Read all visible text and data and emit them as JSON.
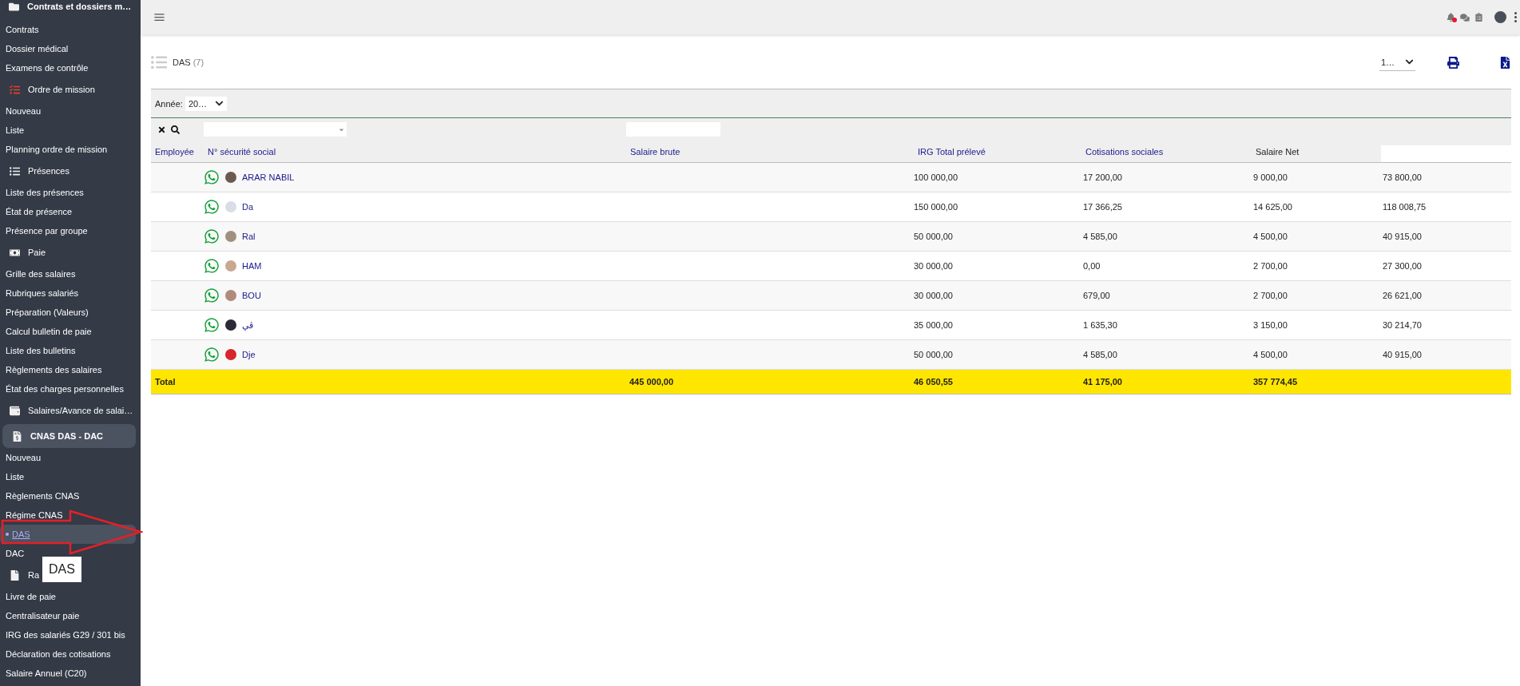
{
  "sidebar": {
    "sections": [
      {
        "kind": "group",
        "label": "Contrats et dossiers m…",
        "selected": false,
        "children": [
          {
            "label": "Contrats",
            "selected": false
          },
          {
            "label": "Dossier médical",
            "selected": false
          },
          {
            "label": "Examens de contrôle",
            "selected": false
          }
        ]
      },
      {
        "kind": "section",
        "label": "Ordre de mission",
        "selected": false,
        "children": [
          {
            "label": "Nouveau",
            "selected": false
          },
          {
            "label": "Liste",
            "selected": false
          },
          {
            "label": "Planning ordre de mission",
            "selected": false
          }
        ]
      },
      {
        "kind": "section",
        "label": "Présences",
        "selected": false,
        "children": [
          {
            "label": "Liste des présences",
            "selected": false
          },
          {
            "label": "État de présence",
            "selected": false
          },
          {
            "label": "Présence par groupe",
            "selected": false
          }
        ]
      },
      {
        "kind": "section",
        "label": "Paie",
        "selected": false,
        "children": [
          {
            "label": "Grille des salaires",
            "selected": false
          },
          {
            "label": "Rubriques salariés",
            "selected": false
          },
          {
            "label": "Préparation (Valeurs)",
            "selected": false
          },
          {
            "label": "Calcul bulletin de paie",
            "selected": false
          },
          {
            "label": "Liste des bulletins",
            "selected": false
          },
          {
            "label": "Règlements des salaires",
            "selected": false
          },
          {
            "label": "État des charges personnelles",
            "selected": false
          }
        ]
      },
      {
        "kind": "section",
        "label": "Salaires/Avance de salai…",
        "selected": false
      },
      {
        "kind": "section",
        "label": "CNAS DAS - DAC",
        "selected": true,
        "children": [
          {
            "label": "Nouveau",
            "selected": false
          },
          {
            "label": "Liste",
            "selected": false
          },
          {
            "label": "Règlements CNAS",
            "selected": false
          },
          {
            "label": "Régime CNAS",
            "selected": false
          },
          {
            "label": "DAS",
            "selected": true
          },
          {
            "label": "DAC",
            "selected": false
          }
        ]
      },
      {
        "kind": "section",
        "label": "Ra",
        "selected": false,
        "tooltip": "DAS",
        "children": [
          {
            "label": "Livre de paie",
            "selected": false
          },
          {
            "label": "Centralisateur paie",
            "selected": false
          },
          {
            "label": "IRG des salariés G29 / 301 bis",
            "selected": false
          },
          {
            "label": "Déclaration des cotisations",
            "selected": false
          },
          {
            "label": "Salaire Annuel (C20)",
            "selected": false
          }
        ]
      }
    ]
  },
  "page": {
    "title": "DAS",
    "count": "(7)",
    "page_size": "1…"
  },
  "filter": {
    "label": "Année:",
    "value": "20…"
  },
  "table": {
    "columns": [
      "Employée",
      "N° sécurité social",
      "Salaire brute",
      "IRG Total prélevé",
      "Cotisations sociales",
      "Salaire Net"
    ],
    "rows": [
      {
        "name": "ARAR NABIL",
        "values": [
          "100 000,00",
          "17 200,00",
          "9 000,00",
          "73 800,00"
        ]
      },
      {
        "name": "Da",
        "values": [
          "150 000,00",
          "17 366,25",
          "14 625,00",
          "118 008,75"
        ]
      },
      {
        "name": "Ral",
        "values": [
          "50 000,00",
          "4 585,00",
          "4 500,00",
          "40 915,00"
        ]
      },
      {
        "name": "HAM",
        "values": [
          "30 000,00",
          "0,00",
          "2 700,00",
          "27 300,00"
        ]
      },
      {
        "name": "BOU",
        "values": [
          "30 000,00",
          "679,00",
          "2 700,00",
          "26 621,00"
        ]
      },
      {
        "name": "ڤي",
        "values": [
          "35 000,00",
          "1 635,30",
          "3 150,00",
          "30 214,70"
        ]
      },
      {
        "name": "Dje",
        "values": [
          "50 000,00",
          "4 585,00",
          "4 500,00",
          "40 915,00"
        ]
      }
    ],
    "total": {
      "label": "Total",
      "values": [
        "445 000,00",
        "46 050,55",
        "41 175,00",
        "357 774,45"
      ]
    }
  }
}
